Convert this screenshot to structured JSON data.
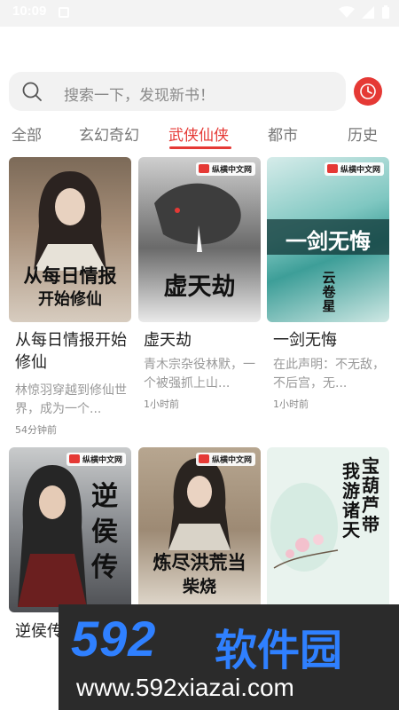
{
  "status_bar": {
    "time": "10:09"
  },
  "search": {
    "placeholder": "搜索一下，发现新书！"
  },
  "tabs": [
    "全部",
    "玄幻奇幻",
    "武侠仙侠",
    "都市",
    "历史"
  ],
  "active_tab": "武侠仙侠",
  "books": [
    {
      "cover_title": "从每日情报开始修仙",
      "cover_title_line1": "从每日情报",
      "cover_title_line2": "开始修仙",
      "title": "从每日情报开始修仙",
      "desc": "林惊羽穿越到修仙世界，成为一个...",
      "time": "54分钟前"
    },
    {
      "cover_badge": "纵横中文网",
      "cover_title": "虚天劫",
      "title": "虚天劫",
      "desc": "青木宗杂役林默，一个被强抓上山...",
      "time": "1小时前"
    },
    {
      "cover_badge": "纵横中文网",
      "cover_title": "一剑无悔",
      "cover_subtitle": "云卷星",
      "title": "一剑无悔",
      "desc": "在此声明：不无敌，不后宫，无...",
      "time": "1小时前"
    },
    {
      "cover_badge": "纵横中文网",
      "cover_title": "逆侯传",
      "title": "逆侯传"
    },
    {
      "cover_badge": "纵横中文网",
      "cover_title": "炼尽洪荒当柴烧",
      "cover_title_line1": "炼尽洪荒当",
      "cover_title_line2": "柴烧"
    },
    {
      "cover_title": "宝葫芦带我游诸天",
      "cover_title_col1": "宝葫芦带",
      "cover_title_col2": "我游诸天"
    }
  ],
  "watermark": {
    "top": "592",
    "top_cn": "软件园",
    "bottom": "www.592xiazai.com"
  },
  "colors": {
    "accent": "#e53935",
    "watermark_blue": "#2f80ff"
  },
  "icons": {
    "search": "search-icon",
    "history": "clock-icon"
  }
}
